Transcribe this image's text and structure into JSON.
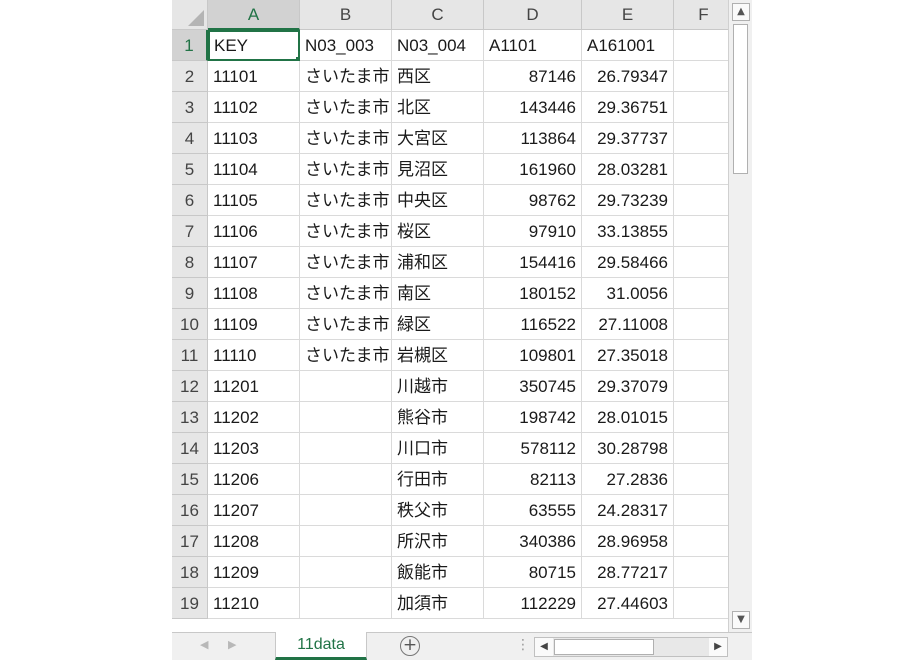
{
  "columns": [
    "A",
    "B",
    "C",
    "D",
    "E",
    "F"
  ],
  "rows": [
    {
      "n": "1",
      "cells": [
        "KEY",
        "N03_003",
        "N03_004",
        "A1101",
        "A161001"
      ]
    },
    {
      "n": "2",
      "cells": [
        "11101",
        "さいたま市",
        "西区",
        "87146",
        "26.79347"
      ]
    },
    {
      "n": "3",
      "cells": [
        "11102",
        "さいたま市",
        "北区",
        "143446",
        "29.36751"
      ]
    },
    {
      "n": "4",
      "cells": [
        "11103",
        "さいたま市",
        "大宮区",
        "113864",
        "29.37737"
      ]
    },
    {
      "n": "5",
      "cells": [
        "11104",
        "さいたま市",
        "見沼区",
        "161960",
        "28.03281"
      ]
    },
    {
      "n": "6",
      "cells": [
        "11105",
        "さいたま市",
        "中央区",
        "98762",
        "29.73239"
      ]
    },
    {
      "n": "7",
      "cells": [
        "11106",
        "さいたま市",
        "桜区",
        "97910",
        "33.13855"
      ]
    },
    {
      "n": "8",
      "cells": [
        "11107",
        "さいたま市",
        "浦和区",
        "154416",
        "29.58466"
      ]
    },
    {
      "n": "9",
      "cells": [
        "11108",
        "さいたま市",
        "南区",
        "180152",
        "31.0056"
      ]
    },
    {
      "n": "10",
      "cells": [
        "11109",
        "さいたま市",
        "緑区",
        "116522",
        "27.11008"
      ]
    },
    {
      "n": "11",
      "cells": [
        "11110",
        "さいたま市",
        "岩槻区",
        "109801",
        "27.35018"
      ]
    },
    {
      "n": "12",
      "cells": [
        "11201",
        "",
        "川越市",
        "350745",
        "29.37079"
      ]
    },
    {
      "n": "13",
      "cells": [
        "11202",
        "",
        "熊谷市",
        "198742",
        "28.01015"
      ]
    },
    {
      "n": "14",
      "cells": [
        "11203",
        "",
        "川口市",
        "578112",
        "30.28798"
      ]
    },
    {
      "n": "15",
      "cells": [
        "11206",
        "",
        "行田市",
        "82113",
        "27.2836"
      ]
    },
    {
      "n": "16",
      "cells": [
        "11207",
        "",
        "秩父市",
        "63555",
        "24.28317"
      ]
    },
    {
      "n": "17",
      "cells": [
        "11208",
        "",
        "所沢市",
        "340386",
        "28.96958"
      ]
    },
    {
      "n": "18",
      "cells": [
        "11209",
        "",
        "飯能市",
        "80715",
        "28.77217"
      ]
    },
    {
      "n": "19",
      "cells": [
        "11210",
        "",
        "加須市",
        "112229",
        "27.44603"
      ]
    }
  ],
  "sheet_tab": {
    "label": "11data"
  },
  "icons": {
    "add_sheet": "plus-circle-icon",
    "scroll_up": "chevron-up-icon",
    "scroll_down": "chevron-down-icon",
    "scroll_left": "chevron-left-icon",
    "scroll_right": "chevron-right-icon"
  },
  "colors": {
    "accent": "#217346"
  }
}
